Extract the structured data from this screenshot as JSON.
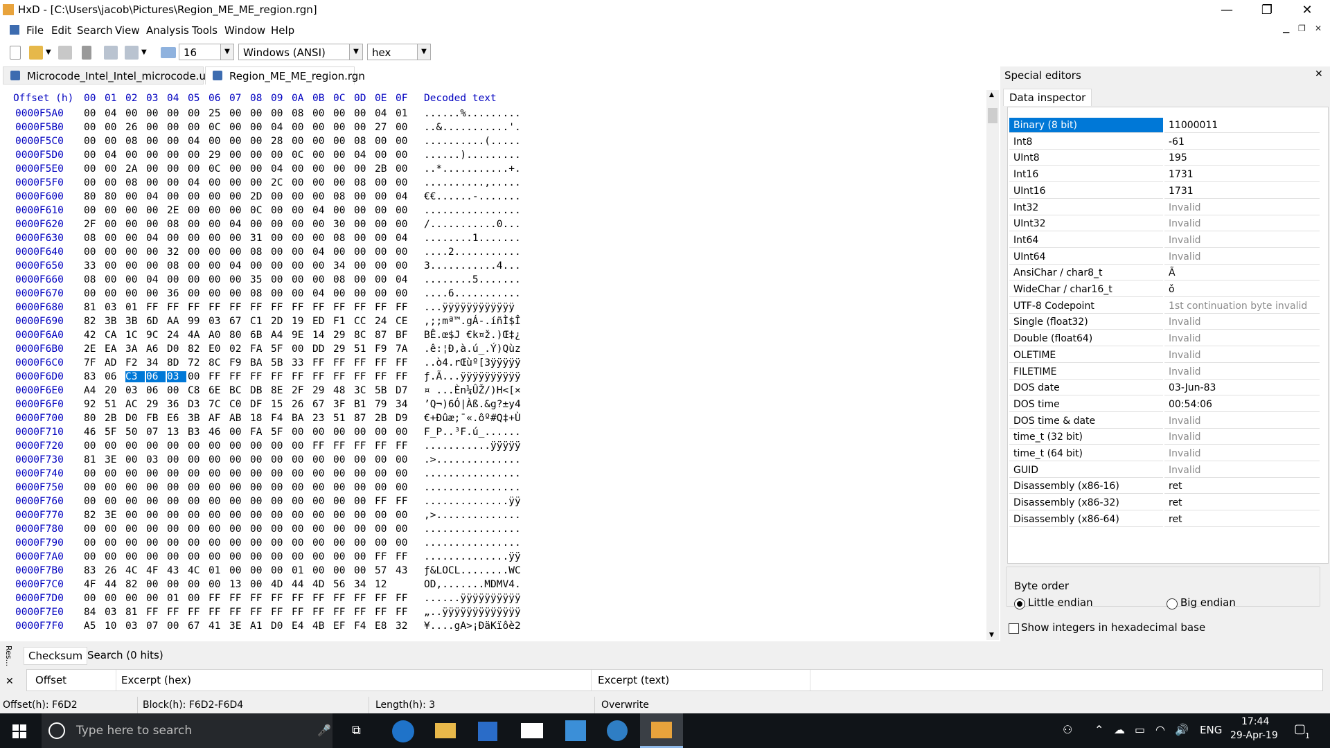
{
  "window": {
    "title": "HxD - [C:\\Users\\jacob\\Pictures\\Region_ME_ME_region.rgn]",
    "controls": [
      "—",
      "❐",
      "✕"
    ]
  },
  "menu": [
    "File",
    "Edit",
    "Search",
    "View",
    "Analysis",
    "Tools",
    "Window",
    "Help"
  ],
  "toolbar": {
    "bytes_per_row": "16",
    "charset": "Windows (ANSI)",
    "offset_base": "hex"
  },
  "tabs": [
    {
      "label": "Microcode_Intel_Intel_microcode.ucd",
      "active": false
    },
    {
      "label": "Region_ME_ME_region.rgn",
      "active": true
    }
  ],
  "hex": {
    "header_offset": "Offset (h)",
    "header_cols": [
      "00",
      "01",
      "02",
      "03",
      "04",
      "05",
      "06",
      "07",
      "08",
      "09",
      "0A",
      "0B",
      "0C",
      "0D",
      "0E",
      "0F"
    ],
    "header_decoded": "Decoded text",
    "rows": [
      {
        "off": "0000F5A0",
        "bytes": [
          "00",
          "04",
          "00",
          "00",
          "00",
          "00",
          "25",
          "00",
          "00",
          "00",
          "08",
          "00",
          "00",
          "00",
          "04",
          "01",
          "00"
        ],
        "text": "......%........."
      },
      {
        "off": "0000F5B0",
        "bytes": [
          "00",
          "00",
          "26",
          "00",
          "00",
          "00",
          "0C",
          "00",
          "00",
          "04",
          "00",
          "00",
          "00",
          "00",
          "27",
          "00"
        ],
        "text": "..&...........'."
      },
      {
        "off": "0000F5C0",
        "bytes": [
          "00",
          "00",
          "08",
          "00",
          "00",
          "04",
          "00",
          "00",
          "00",
          "28",
          "00",
          "00",
          "00",
          "08",
          "00",
          "00"
        ],
        "text": "..........(....."
      },
      {
        "off": "0000F5D0",
        "bytes": [
          "00",
          "04",
          "00",
          "00",
          "00",
          "00",
          "29",
          "00",
          "00",
          "00",
          "0C",
          "00",
          "00",
          "04",
          "00",
          "00"
        ],
        "text": "......)........."
      },
      {
        "off": "0000F5E0",
        "bytes": [
          "00",
          "00",
          "2A",
          "00",
          "00",
          "00",
          "0C",
          "00",
          "00",
          "04",
          "00",
          "00",
          "00",
          "00",
          "2B",
          "00"
        ],
        "text": "..*...........+."
      },
      {
        "off": "0000F5F0",
        "bytes": [
          "00",
          "00",
          "08",
          "00",
          "00",
          "04",
          "00",
          "00",
          "00",
          "2C",
          "00",
          "00",
          "00",
          "08",
          "00",
          "00"
        ],
        "text": "..........,....."
      },
      {
        "off": "0000F600",
        "bytes": [
          "80",
          "80",
          "00",
          "04",
          "00",
          "00",
          "00",
          "00",
          "2D",
          "00",
          "00",
          "00",
          "08",
          "00",
          "00",
          "04"
        ],
        "text": "€€......-......."
      },
      {
        "off": "0000F610",
        "bytes": [
          "00",
          "00",
          "00",
          "00",
          "2E",
          "00",
          "00",
          "00",
          "0C",
          "00",
          "00",
          "04",
          "00",
          "00",
          "00",
          "00"
        ],
        "text": "................"
      },
      {
        "off": "0000F620",
        "bytes": [
          "2F",
          "00",
          "00",
          "00",
          "08",
          "00",
          "00",
          "04",
          "00",
          "00",
          "00",
          "00",
          "30",
          "00",
          "00",
          "00"
        ],
        "text": "/...........0..."
      },
      {
        "off": "0000F630",
        "bytes": [
          "08",
          "00",
          "00",
          "04",
          "00",
          "00",
          "00",
          "00",
          "31",
          "00",
          "00",
          "00",
          "08",
          "00",
          "00",
          "04"
        ],
        "text": "........1......."
      },
      {
        "off": "0000F640",
        "bytes": [
          "00",
          "00",
          "00",
          "00",
          "32",
          "00",
          "00",
          "00",
          "08",
          "00",
          "00",
          "04",
          "00",
          "00",
          "00",
          "00"
        ],
        "text": "....2..........."
      },
      {
        "off": "0000F650",
        "bytes": [
          "33",
          "00",
          "00",
          "00",
          "08",
          "00",
          "00",
          "04",
          "00",
          "00",
          "00",
          "00",
          "34",
          "00",
          "00",
          "00"
        ],
        "text": "3...........4..."
      },
      {
        "off": "0000F660",
        "bytes": [
          "08",
          "00",
          "00",
          "04",
          "00",
          "00",
          "00",
          "00",
          "35",
          "00",
          "00",
          "00",
          "08",
          "00",
          "00",
          "04"
        ],
        "text": "........5......."
      },
      {
        "off": "0000F670",
        "bytes": [
          "00",
          "00",
          "00",
          "00",
          "36",
          "00",
          "00",
          "00",
          "08",
          "00",
          "00",
          "04",
          "00",
          "00",
          "00",
          "00"
        ],
        "text": "....6..........."
      },
      {
        "off": "0000F680",
        "bytes": [
          "81",
          "03",
          "01",
          "FF",
          "FF",
          "FF",
          "FF",
          "FF",
          "FF",
          "FF",
          "FF",
          "FF",
          "FF",
          "FF",
          "FF",
          "FF"
        ],
        "text": "...ÿÿÿÿÿÿÿÿÿÿÿÿ"
      },
      {
        "off": "0000F690",
        "bytes": [
          "82",
          "3B",
          "3B",
          "6D",
          "AA",
          "99",
          "03",
          "67",
          "C1",
          "2D",
          "19",
          "ED",
          "F1",
          "CC",
          "24",
          "CE"
        ],
        "text": "‚;;mª™.gÁ-.íñÌ$Î"
      },
      {
        "off": "0000F6A0",
        "bytes": [
          "42",
          "CA",
          "1C",
          "9C",
          "24",
          "4A",
          "A0",
          "80",
          "6B",
          "A4",
          "9E",
          "14",
          "29",
          "8C",
          "87",
          "BF"
        ],
        "text": "BÊ.œ$J €k¤ž.)Œ‡¿"
      },
      {
        "off": "0000F6B0",
        "bytes": [
          "2E",
          "EA",
          "3A",
          "A6",
          "D0",
          "82",
          "E0",
          "02",
          "FA",
          "5F",
          "00",
          "DD",
          "29",
          "51",
          "F9",
          "7A"
        ],
        "text": ".ê:¦Ð‚à.ú_.Ý)Qùz"
      },
      {
        "off": "0000F6C0",
        "bytes": [
          "7F",
          "AD",
          "F2",
          "34",
          "8D",
          "72",
          "8C",
          "F9",
          "BA",
          "5B",
          "33",
          "FF",
          "FF",
          "FF",
          "FF",
          "FF"
        ],
        "text": "..ò4.rŒùº[3ÿÿÿÿÿ"
      },
      {
        "off": "0000F6D0",
        "bytes": [
          "83",
          "06",
          "C3",
          "06",
          "03",
          "00",
          "FF",
          "FF",
          "FF",
          "FF",
          "FF",
          "FF",
          "FF",
          "FF",
          "FF",
          "FF"
        ],
        "text": "ƒ.Ã...ÿÿÿÿÿÿÿÿÿÿ"
      },
      {
        "off": "0000F6E0",
        "bytes": [
          "A4",
          "20",
          "03",
          "06",
          "00",
          "C8",
          "6E",
          "BC",
          "DB",
          "8E",
          "2F",
          "29",
          "48",
          "3C",
          "5B",
          "D7"
        ],
        "text": "¤ ...Èn¼ÛŽ/)H<[×"
      },
      {
        "off": "0000F6F0",
        "bytes": [
          "92",
          "51",
          "AC",
          "29",
          "36",
          "D3",
          "7C",
          "C0",
          "DF",
          "15",
          "26",
          "67",
          "3F",
          "B1",
          "79",
          "34"
        ],
        "text": "’Q¬)6Ó|Àß.&g?±y4"
      },
      {
        "off": "0000F700",
        "bytes": [
          "80",
          "2B",
          "D0",
          "FB",
          "E6",
          "3B",
          "AF",
          "AB",
          "18",
          "F4",
          "BA",
          "23",
          "51",
          "87",
          "2B",
          "D9"
        ],
        "text": "€+Ðûæ;¯«.ôº#Q‡+Ù"
      },
      {
        "off": "0000F710",
        "bytes": [
          "46",
          "5F",
          "50",
          "07",
          "13",
          "B3",
          "46",
          "00",
          "FA",
          "5F",
          "00",
          "00",
          "00",
          "00",
          "00",
          "00"
        ],
        "text": "F_P..³F.ú_......"
      },
      {
        "off": "0000F720",
        "bytes": [
          "00",
          "00",
          "00",
          "00",
          "00",
          "00",
          "00",
          "00",
          "00",
          "00",
          "00",
          "FF",
          "FF",
          "FF",
          "FF",
          "FF"
        ],
        "text": "...........ÿÿÿÿÿ"
      },
      {
        "off": "0000F730",
        "bytes": [
          "81",
          "3E",
          "00",
          "03",
          "00",
          "00",
          "00",
          "00",
          "00",
          "00",
          "00",
          "00",
          "00",
          "00",
          "00",
          "00"
        ],
        "text": ".>.............."
      },
      {
        "off": "0000F740",
        "bytes": [
          "00",
          "00",
          "00",
          "00",
          "00",
          "00",
          "00",
          "00",
          "00",
          "00",
          "00",
          "00",
          "00",
          "00",
          "00",
          "00"
        ],
        "text": "................"
      },
      {
        "off": "0000F750",
        "bytes": [
          "00",
          "00",
          "00",
          "00",
          "00",
          "00",
          "00",
          "00",
          "00",
          "00",
          "00",
          "00",
          "00",
          "00",
          "00",
          "00"
        ],
        "text": "................"
      },
      {
        "off": "0000F760",
        "bytes": [
          "00",
          "00",
          "00",
          "00",
          "00",
          "00",
          "00",
          "00",
          "00",
          "00",
          "00",
          "00",
          "00",
          "00",
          "FF",
          "FF"
        ],
        "text": "..............ÿÿ"
      },
      {
        "off": "0000F770",
        "bytes": [
          "82",
          "3E",
          "00",
          "00",
          "00",
          "00",
          "00",
          "00",
          "00",
          "00",
          "00",
          "00",
          "00",
          "00",
          "00",
          "00"
        ],
        "text": "‚>.............."
      },
      {
        "off": "0000F780",
        "bytes": [
          "00",
          "00",
          "00",
          "00",
          "00",
          "00",
          "00",
          "00",
          "00",
          "00",
          "00",
          "00",
          "00",
          "00",
          "00",
          "00"
        ],
        "text": "................"
      },
      {
        "off": "0000F790",
        "bytes": [
          "00",
          "00",
          "00",
          "00",
          "00",
          "00",
          "00",
          "00",
          "00",
          "00",
          "00",
          "00",
          "00",
          "00",
          "00",
          "00"
        ],
        "text": "................"
      },
      {
        "off": "0000F7A0",
        "bytes": [
          "00",
          "00",
          "00",
          "00",
          "00",
          "00",
          "00",
          "00",
          "00",
          "00",
          "00",
          "00",
          "00",
          "00",
          "FF",
          "FF"
        ],
        "text": "..............ÿÿ"
      },
      {
        "off": "0000F7B0",
        "bytes": [
          "83",
          "26",
          "4C",
          "4F",
          "43",
          "4C",
          "01",
          "00",
          "00",
          "00",
          "01",
          "00",
          "00",
          "00",
          "57",
          "43"
        ],
        "text": "ƒ&LOCL........WC"
      },
      {
        "off": "0000F7C0",
        "bytes": [
          "4F",
          "44",
          "82",
          "00",
          "00",
          "00",
          "00",
          "13",
          "00",
          "4D",
          "44",
          "4D",
          "56",
          "34",
          "12"
        ],
        "text": "OD,.......MDMV4."
      },
      {
        "off": "0000F7D0",
        "bytes": [
          "00",
          "00",
          "00",
          "00",
          "01",
          "00",
          "FF",
          "FF",
          "FF",
          "FF",
          "FF",
          "FF",
          "FF",
          "FF",
          "FF",
          "FF"
        ],
        "text": "......ÿÿÿÿÿÿÿÿÿÿ"
      },
      {
        "off": "0000F7E0",
        "bytes": [
          "84",
          "03",
          "81",
          "FF",
          "FF",
          "FF",
          "FF",
          "FF",
          "FF",
          "FF",
          "FF",
          "FF",
          "FF",
          "FF",
          "FF",
          "FF"
        ],
        "text": "„..ÿÿÿÿÿÿÿÿÿÿÿÿÿ"
      },
      {
        "off": "0000F7F0",
        "bytes": [
          "A5",
          "10",
          "03",
          "07",
          "00",
          "67",
          "41",
          "3E",
          "A1",
          "D0",
          "E4",
          "4B",
          "EF",
          "F4",
          "E8",
          "32"
        ],
        "text": "¥....gA>¡ÐäKïôè2"
      }
    ]
  },
  "special_editors": {
    "title": "Special editors",
    "close": "✕",
    "tab": "Data inspector",
    "rows": [
      {
        "k": "Binary (8 bit)",
        "v": "11000011",
        "inv": false
      },
      {
        "k": "Int8",
        "v": "-61",
        "inv": false
      },
      {
        "k": "UInt8",
        "v": "195",
        "inv": false
      },
      {
        "k": "Int16",
        "v": "1731",
        "inv": false
      },
      {
        "k": "UInt16",
        "v": "1731",
        "inv": false
      },
      {
        "k": "Int32",
        "v": "Invalid",
        "inv": true
      },
      {
        "k": "UInt32",
        "v": "Invalid",
        "inv": true
      },
      {
        "k": "Int64",
        "v": "Invalid",
        "inv": true
      },
      {
        "k": "UInt64",
        "v": "Invalid",
        "inv": true
      },
      {
        "k": "AnsiChar / char8_t",
        "v": "Ã",
        "inv": false
      },
      {
        "k": "WideChar / char16_t",
        "v": "ǒ",
        "inv": false
      },
      {
        "k": "UTF-8 Codepoint",
        "v": "1st continuation byte invalid",
        "inv": true
      },
      {
        "k": "Single (float32)",
        "v": "Invalid",
        "inv": true
      },
      {
        "k": "Double (float64)",
        "v": "Invalid",
        "inv": true
      },
      {
        "k": "OLETIME",
        "v": "Invalid",
        "inv": true
      },
      {
        "k": "FILETIME",
        "v": "Invalid",
        "inv": true
      },
      {
        "k": "DOS date",
        "v": "03-Jun-83",
        "inv": false
      },
      {
        "k": "DOS time",
        "v": "00:54:06",
        "inv": false
      },
      {
        "k": "DOS time & date",
        "v": "Invalid",
        "inv": true
      },
      {
        "k": "time_t (32 bit)",
        "v": "Invalid",
        "inv": true
      },
      {
        "k": "time_t (64 bit)",
        "v": "Invalid",
        "inv": true
      },
      {
        "k": "GUID",
        "v": "Invalid",
        "inv": true
      },
      {
        "k": "Disassembly (x86-16)",
        "v": "ret",
        "inv": false
      },
      {
        "k": "Disassembly (x86-32)",
        "v": "ret",
        "inv": false
      },
      {
        "k": "Disassembly (x86-64)",
        "v": "ret",
        "inv": false
      }
    ],
    "byte_order_label": "Byte order",
    "little_endian": "Little endian",
    "big_endian": "Big endian",
    "hex_base_label": "Show integers in hexadecimal base"
  },
  "results": {
    "side_label": "Res...",
    "close": "✕",
    "tabs": [
      "Checksum",
      "Search (0 hits)"
    ],
    "columns": [
      "Offset",
      "Excerpt (hex)",
      "Excerpt (text)"
    ]
  },
  "status": {
    "offset": "Offset(h): F6D2",
    "block": "Block(h): F6D2-F6D4",
    "length": "Length(h): 3",
    "mode": "Overwrite"
  },
  "taskbar": {
    "search_placeholder": "Type here to search",
    "lang": "ENG",
    "time": "17:44",
    "date": "29-Apr-19",
    "notif_count": "1"
  }
}
